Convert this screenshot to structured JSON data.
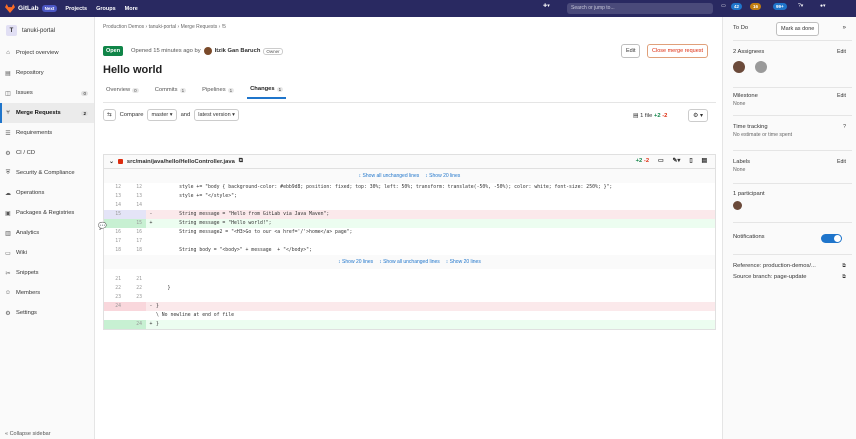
{
  "nav": {
    "brand": "GitLab",
    "badge": "Next",
    "links": [
      "Projects",
      "Groups",
      "More"
    ],
    "search_placeholder": "Search or jump to...",
    "counts": {
      "issues": "42",
      "mrs": "16",
      "todos": "99+"
    }
  },
  "sidebar": {
    "project_initial": "T",
    "project_name": "tanuki-portal",
    "items": [
      {
        "label": "Project overview",
        "icon": "home-icon",
        "icon_glyph": "⌂"
      },
      {
        "label": "Repository",
        "icon": "book-icon",
        "icon_glyph": "▤"
      },
      {
        "label": "Issues",
        "icon": "issues-icon",
        "icon_glyph": "◫",
        "count": "0"
      },
      {
        "label": "Merge Requests",
        "icon": "merge-request-icon",
        "icon_glyph": "⑂",
        "count": "2",
        "active": true
      },
      {
        "label": "Requirements",
        "icon": "requirements-icon",
        "icon_glyph": "☰"
      },
      {
        "label": "CI / CD",
        "icon": "rocket-icon",
        "icon_glyph": "⚙"
      },
      {
        "label": "Security & Compliance",
        "icon": "shield-icon",
        "icon_glyph": "⛨"
      },
      {
        "label": "Operations",
        "icon": "cloud-icon",
        "icon_glyph": "☁"
      },
      {
        "label": "Packages & Registries",
        "icon": "package-icon",
        "icon_glyph": "▣"
      },
      {
        "label": "Analytics",
        "icon": "chart-icon",
        "icon_glyph": "▥"
      },
      {
        "label": "Wiki",
        "icon": "wiki-icon",
        "icon_glyph": "▭"
      },
      {
        "label": "Snippets",
        "icon": "snippet-icon",
        "icon_glyph": "✂"
      },
      {
        "label": "Members",
        "icon": "users-icon",
        "icon_glyph": "☺"
      },
      {
        "label": "Settings",
        "icon": "settings-icon",
        "icon_glyph": "⚙"
      }
    ],
    "collapse_label": "« Collapse sidebar"
  },
  "breadcrumb": [
    "Production Demos",
    "tanuki-portal",
    "Merge Requests",
    "!5"
  ],
  "mr": {
    "status": "Open",
    "opened": "Opened 15 minutes ago by",
    "author": "Itzik Gan Baruch",
    "role": "Owner",
    "title": "Hello world",
    "edit_label": "Edit",
    "close_label": "Close merge request"
  },
  "tabs": [
    {
      "label": "Overview",
      "count": "0"
    },
    {
      "label": "Commits",
      "count": "1"
    },
    {
      "label": "Pipelines",
      "count": "1"
    },
    {
      "label": "Changes",
      "count": "1",
      "active": true
    }
  ],
  "compare": {
    "label": "Compare",
    "source": "master",
    "and": "and",
    "target": "latest version"
  },
  "file_stats": {
    "files": "1 file",
    "added": "+2",
    "removed": "-2"
  },
  "diff": {
    "path": "src/main/java/hello/HelloController.java",
    "added": "+2",
    "removed": "-2",
    "expand_top": [
      "↕ Show all unchanged lines",
      "↕ Show 20 lines"
    ],
    "expand_mid": [
      "↕ Show 20 lines",
      "↕ Show all unchanged lines",
      "↕ Show 20 lines"
    ],
    "lines1": [
      {
        "o": "12",
        "n": "12",
        "t": "c",
        "s": "",
        "code": "        style += \"body { background-color: #ebb9d8; position: fixed; top: 30%; left: 50%; transform: translate(-50%, -50%); color: white; font-size: 250%; }\";"
      },
      {
        "o": "13",
        "n": "13",
        "t": "c",
        "s": "",
        "code": "        style += \"</style>\";"
      },
      {
        "o": "14",
        "n": "14",
        "t": "c",
        "s": "",
        "code": ""
      },
      {
        "o": "15",
        "n": "",
        "t": "h",
        "s": "-",
        "code": "        String message = \"Hello from GitLab via Java Maven\";"
      },
      {
        "o": "",
        "n": "15",
        "t": "a",
        "s": "+",
        "code": "        String message = \"Hello world!\";"
      },
      {
        "o": "16",
        "n": "16",
        "t": "c",
        "s": "",
        "code": "        String message2 = \"<H3>Go to our <a href='/'>home</a> page\";"
      },
      {
        "o": "17",
        "n": "17",
        "t": "c",
        "s": "",
        "code": ""
      },
      {
        "o": "18",
        "n": "18",
        "t": "c",
        "s": "",
        "code": "        String body = \"<body>\" + message  + \"</body>\";"
      }
    ],
    "lines2": [
      {
        "o": "21",
        "n": "21",
        "t": "c",
        "s": "",
        "code": ""
      },
      {
        "o": "22",
        "n": "22",
        "t": "c",
        "s": "",
        "code": "    }"
      },
      {
        "o": "23",
        "n": "23",
        "t": "c",
        "s": "",
        "code": ""
      },
      {
        "o": "24",
        "n": "",
        "t": "d",
        "s": "-",
        "code": "}"
      },
      {
        "o": "",
        "n": "",
        "t": "c",
        "s": "",
        "code": "\\ No newline at end of file"
      },
      {
        "o": "",
        "n": "24",
        "t": "a",
        "s": "+",
        "code": "}"
      }
    ]
  },
  "right": {
    "todo": "To Do",
    "mark_done": "Mark as done",
    "assignees": "2 Assignees",
    "edit": "Edit",
    "milestone": "Milestone",
    "none": "None",
    "time_tracking": "Time tracking",
    "no_estimate": "No estimate or time spent",
    "labels": "Labels",
    "participants": "1 participant",
    "notifications": "Notifications",
    "reference": "Reference: production-demos/...",
    "source_branch": "Source branch: page-update"
  },
  "colors": {
    "nav": "#292961",
    "accent": "#1f75cb",
    "open": "#108548"
  }
}
